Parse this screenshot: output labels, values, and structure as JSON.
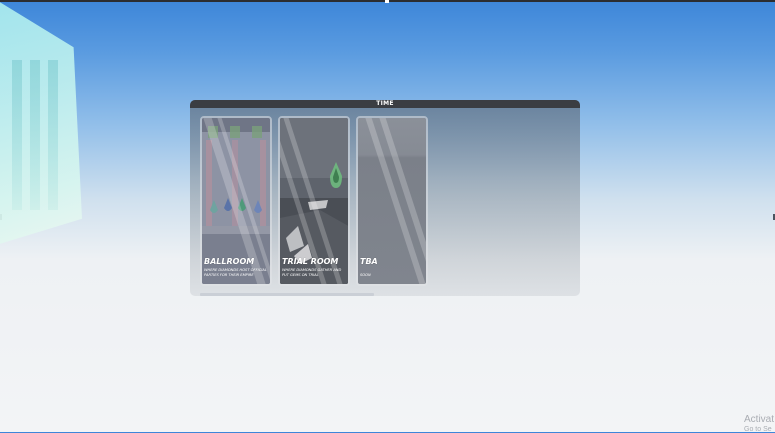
{
  "panel": {
    "title": "TIME",
    "cards": [
      {
        "title": "BALLROOM",
        "description": "WHERE DIAMONDS HOST OFFICIAL PARTIES FOR THEIR EMPIRE"
      },
      {
        "title": "TRIAL ROOM",
        "description": "WHERE DIAMONDS GATHER AND PUT GEMS ON TRIAL"
      },
      {
        "title": "TBA",
        "description": "SOON"
      }
    ]
  },
  "watermark": {
    "line1": "Activat",
    "line2": "Go to Se"
  }
}
